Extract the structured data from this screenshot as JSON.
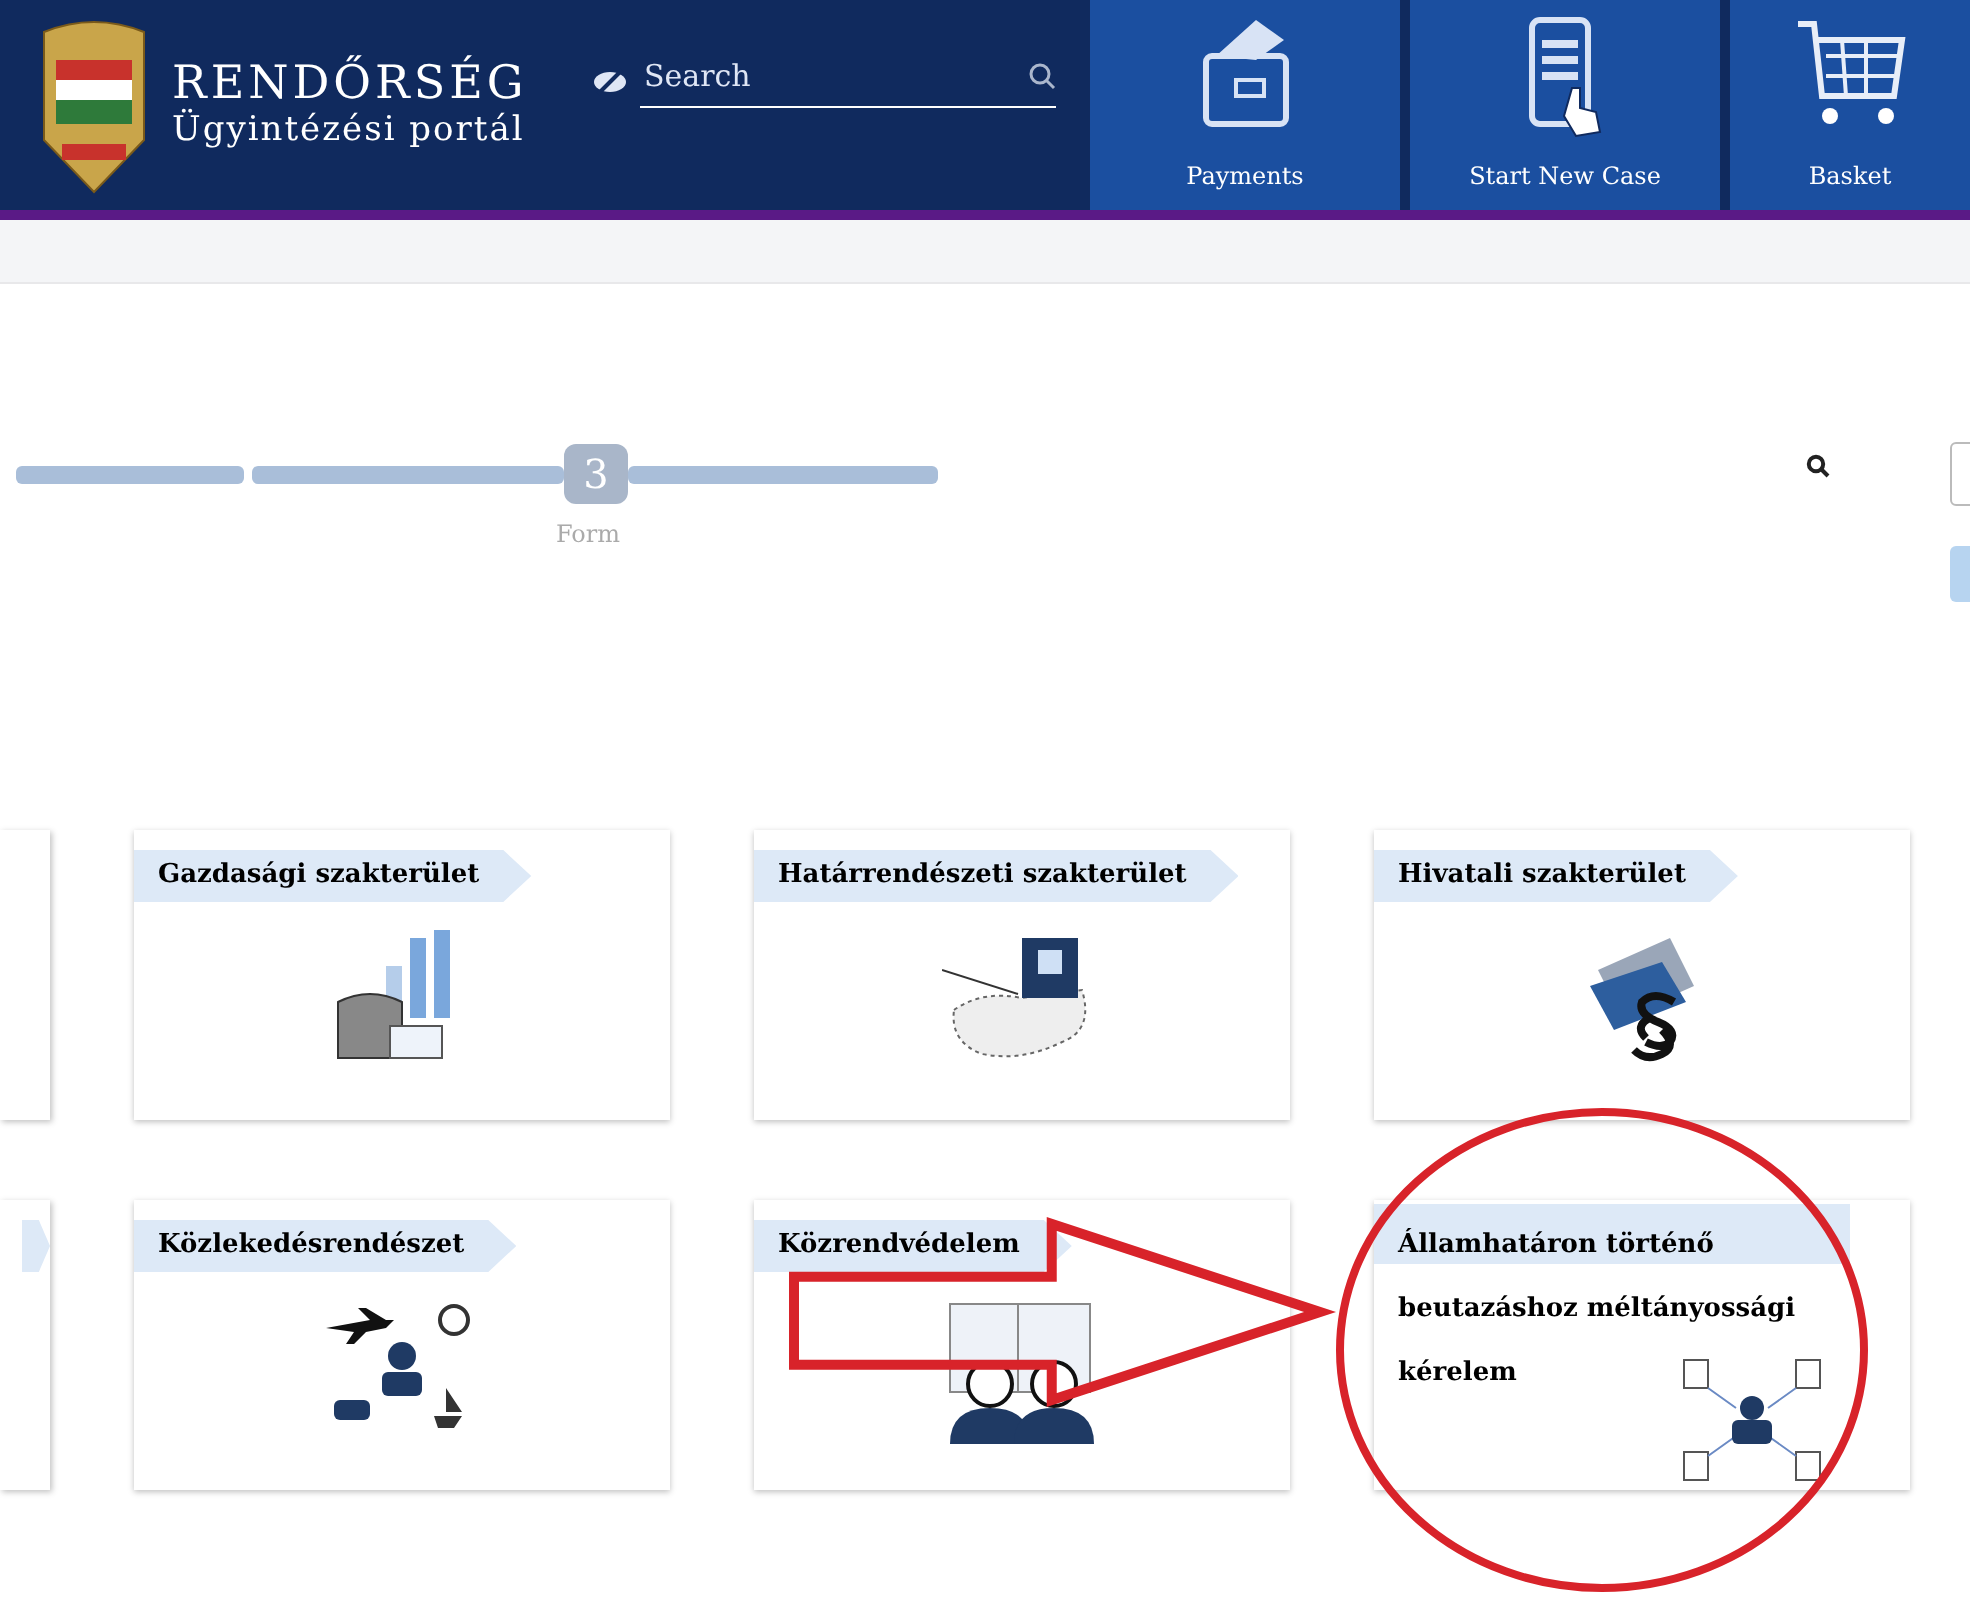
{
  "header": {
    "brand_title": "RENDŐRSÉG",
    "brand_subtitle": "Ügyintézési portál",
    "search": {
      "placeholder": "Search"
    },
    "nav": [
      {
        "label": "Payments",
        "kind": "wallet"
      },
      {
        "label": "Start New Case",
        "kind": "phone"
      },
      {
        "label": "Basket",
        "kind": "cart"
      }
    ]
  },
  "stepper": {
    "step_number": "3",
    "step_label": "Form"
  },
  "card_rows": [
    {
      "partial_tag": false,
      "cards": [
        {
          "title": "Gazdasági szakterület",
          "kind": "money"
        },
        {
          "title": "Határrendészeti szakterület",
          "kind": "border"
        },
        {
          "title": "Hivatali szakterület",
          "kind": "law"
        }
      ]
    },
    {
      "partial_tag": true,
      "cards": [
        {
          "title": "Közlekedésrendészet",
          "kind": "traffic"
        },
        {
          "title": "Közrendvédelem",
          "kind": "officers"
        },
        {
          "title": "Államhatáron történő beutazáshoz méltányossági kérelem",
          "kind": "network"
        }
      ]
    }
  ],
  "annotations": [
    {
      "kind": "arrow"
    },
    {
      "kind": "ellipse"
    }
  ]
}
